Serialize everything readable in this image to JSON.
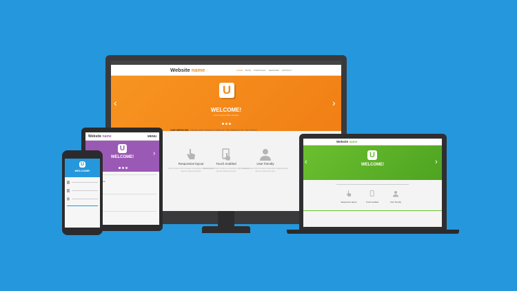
{
  "colors": {
    "background": "#2597dc",
    "desktop_accent": "#f58a1f",
    "tablet_accent": "#9b59b6",
    "laptop_accent": "#6bbf2f",
    "phone_accent": "#2597dc"
  },
  "desktop": {
    "logo_prefix": "Website",
    "logo_suffix": "name",
    "menu": [
      "Home",
      "Blog",
      "Portfolio",
      "Services",
      "Contact"
    ],
    "hero_logo_letter": "U",
    "hero_title": "WELCOME!",
    "hero_subtitle": "Lorem ipsum dolor sit amet",
    "services_heading": "OUR SERVICES:",
    "services_tagline": "THESE ARE HANDLE DISPLAY THE MIDDLE OF THE RIGHT",
    "features": [
      {
        "title": "Responsive layout",
        "icon": "hand-pointer-icon"
      },
      {
        "title": "Touch enabled",
        "icon": "touch-phone-icon"
      },
      {
        "title": "User friendly",
        "icon": "user-icon"
      }
    ],
    "feature_text": "Lorem ipsum dolor sit amet consectetur adipiscing elit sed do eiusmod tempor"
  },
  "tablet": {
    "logo_prefix": "Website",
    "logo_suffix": "name",
    "menu_label": "MENU",
    "hero_logo_letter": "U",
    "hero_title": "WELCOME!",
    "features": [
      "Responsive layout",
      "Touch enabled",
      "User friendly"
    ]
  },
  "phone": {
    "hero_logo_letter": "U",
    "hero_title": "WELCOME!"
  },
  "laptop": {
    "logo_prefix": "Website",
    "logo_suffix": "name",
    "hero_logo_letter": "U",
    "hero_title": "WELCOME!",
    "features": [
      "Responsive layout",
      "Touch enabled",
      "User friendly"
    ]
  }
}
